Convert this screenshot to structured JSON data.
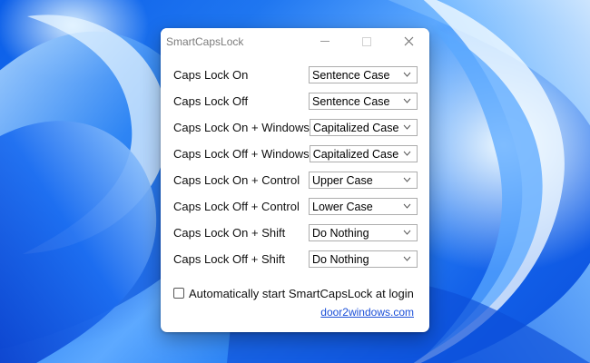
{
  "window": {
    "title": "SmartCapsLock",
    "controls": {
      "minimize_icon": "minimize-icon",
      "maximize_icon": "maximize-icon",
      "close_icon": "close-icon"
    }
  },
  "rules": [
    {
      "label": "Caps Lock On",
      "value": "Sentence Case"
    },
    {
      "label": "Caps Lock Off",
      "value": "Sentence Case"
    },
    {
      "label": "Caps Lock On + Windows",
      "value": "Capitalized Case"
    },
    {
      "label": "Caps Lock Off + Windows",
      "value": "Capitalized Case"
    },
    {
      "label": "Caps Lock On + Control",
      "value": "Upper Case"
    },
    {
      "label": "Caps Lock Off + Control",
      "value": "Lower Case"
    },
    {
      "label": "Caps Lock On + Shift",
      "value": "Do Nothing"
    },
    {
      "label": "Caps Lock Off + Shift",
      "value": "Do Nothing"
    }
  ],
  "autostart": {
    "label": "Automatically start SmartCapsLock at login",
    "checked": false
  },
  "footer": {
    "link_text": "door2windows.com"
  },
  "theme": {
    "link_color": "#1b4fd8",
    "wallpaper_primary": "#0a5de8",
    "wallpaper_highlight": "#eaf6ff"
  }
}
